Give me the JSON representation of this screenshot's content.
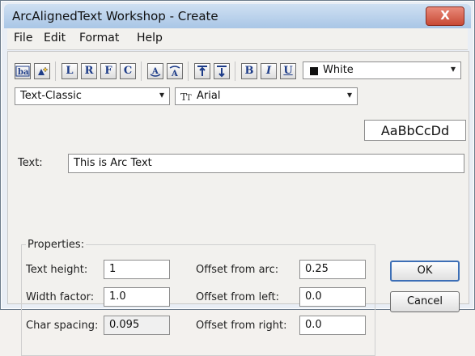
{
  "window": {
    "title": "ArcAlignedText Workshop - Create",
    "close_glyph": "X"
  },
  "menu": {
    "items": [
      "File",
      "Edit",
      "Format",
      "Help"
    ]
  },
  "toolbar": {
    "buttons": {
      "L": "L",
      "R": "R",
      "F": "F",
      "C": "C",
      "B": "B",
      "I": "I",
      "U": "U"
    },
    "color": {
      "value": "White"
    }
  },
  "style_select": {
    "value": "Text-Classic"
  },
  "font_select": {
    "value": "Arial"
  },
  "preview": {
    "value": "AaBbCcDd"
  },
  "text_field": {
    "label": "Text:",
    "value": "This is Arc Text"
  },
  "properties": {
    "label": "Properties:",
    "text_height": {
      "label": "Text height:",
      "value": "1"
    },
    "width_factor": {
      "label": "Width factor:",
      "value": "1.0"
    },
    "char_spacing": {
      "label": "Char spacing:",
      "value": "0.095"
    },
    "offset_from_arc": {
      "label": "Offset from arc:",
      "value": "0.25"
    },
    "offset_from_left": {
      "label": "Offset from left:",
      "value": "0.0"
    },
    "offset_from_right": {
      "label": "Offset from right:",
      "value": "0.0"
    }
  },
  "buttons": {
    "ok": "OK",
    "cancel": "Cancel"
  },
  "icons": {
    "ba": "ba-icon",
    "sparkle": "sparkle-icon",
    "arc_under": "arc-under-icon",
    "arc_over": "arc-over-icon",
    "up_align": "align-top-icon",
    "down_align": "align-bottom-icon",
    "font": "font-icon"
  }
}
